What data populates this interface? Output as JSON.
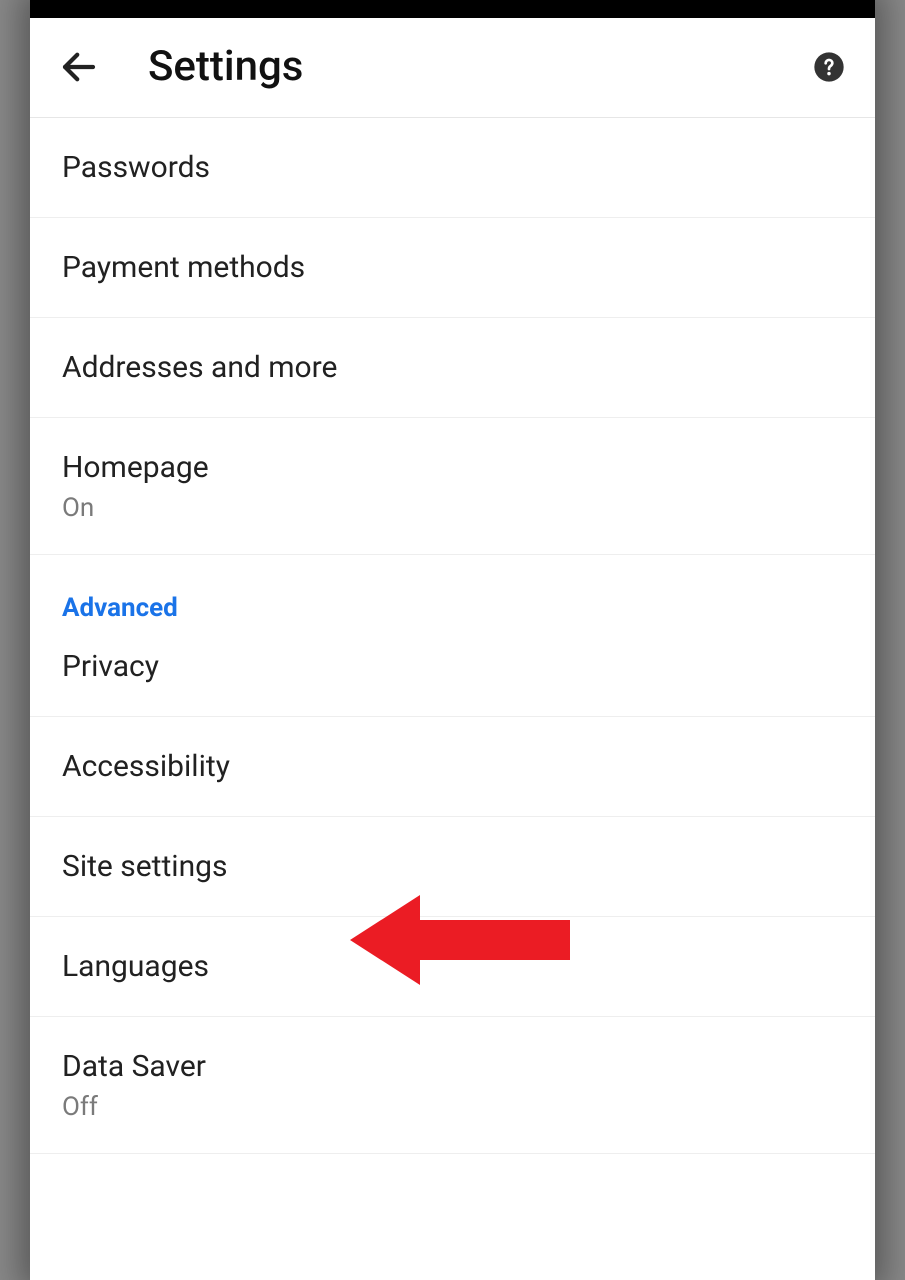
{
  "header": {
    "title": "Settings"
  },
  "sections": [
    {
      "items": [
        {
          "label": "Passwords"
        },
        {
          "label": "Payment methods"
        },
        {
          "label": "Addresses and more"
        },
        {
          "label": "Homepage",
          "sub": "On"
        }
      ]
    },
    {
      "title": "Advanced",
      "items": [
        {
          "label": "Privacy"
        },
        {
          "label": "Accessibility"
        },
        {
          "label": "Site settings"
        },
        {
          "label": "Languages"
        },
        {
          "label": "Data Saver",
          "sub": "Off"
        }
      ]
    }
  ],
  "colors": {
    "accent": "#1a73e8",
    "annotation": "#eb1c24"
  }
}
